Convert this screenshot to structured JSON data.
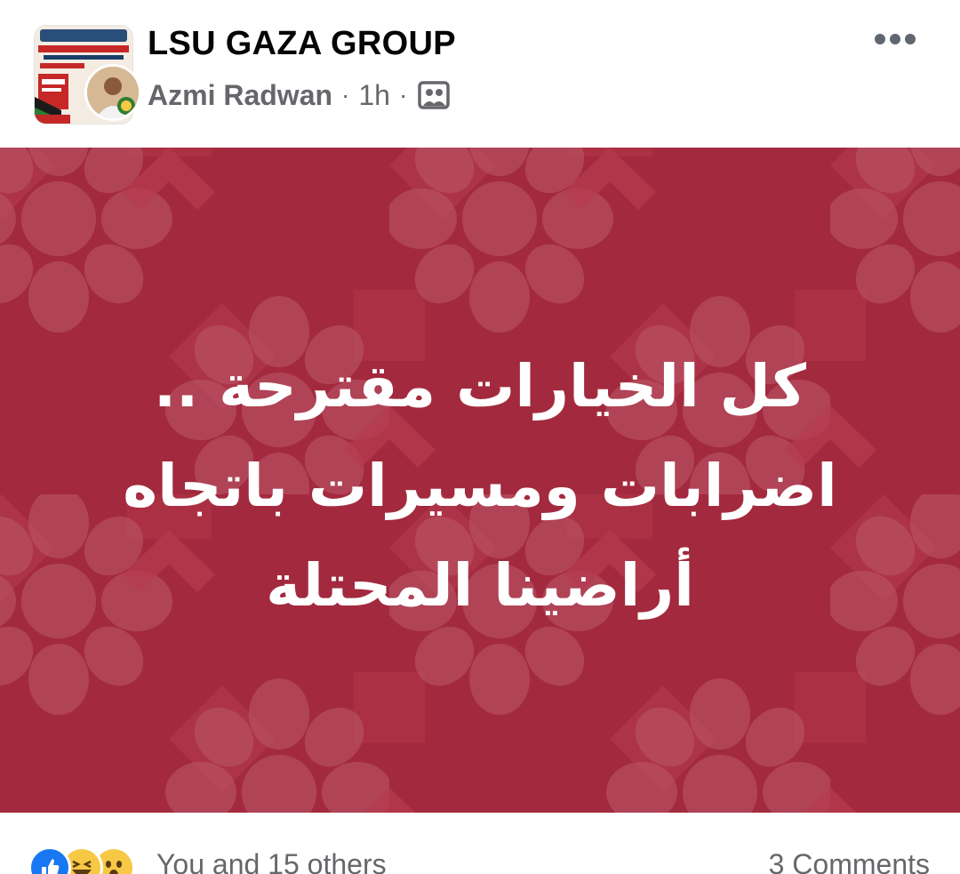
{
  "post": {
    "group_name": "LSU GAZA GROUP",
    "author": "Azmi Radwan",
    "separator": "·",
    "time": "1h",
    "audience_icon": "group-photo-icon",
    "more_icon": "more-horizontal-icon",
    "text_lines": [
      "كل الخيارات مقترحة ..",
      "اضرابات ومسيرات باتجاه",
      "أراضينا المحتلة"
    ],
    "background_color": "#a32a3e"
  },
  "footer": {
    "reaction_icons": [
      "like-icon",
      "haha-icon",
      "wow-icon"
    ],
    "reactions_text": "You and 15 others",
    "comments_text": "3 Comments"
  },
  "colors": {
    "primary_text": "#050505",
    "secondary_text": "#65676b",
    "like_blue": "#1877f2",
    "emoji_yellow": "#f7c843"
  }
}
